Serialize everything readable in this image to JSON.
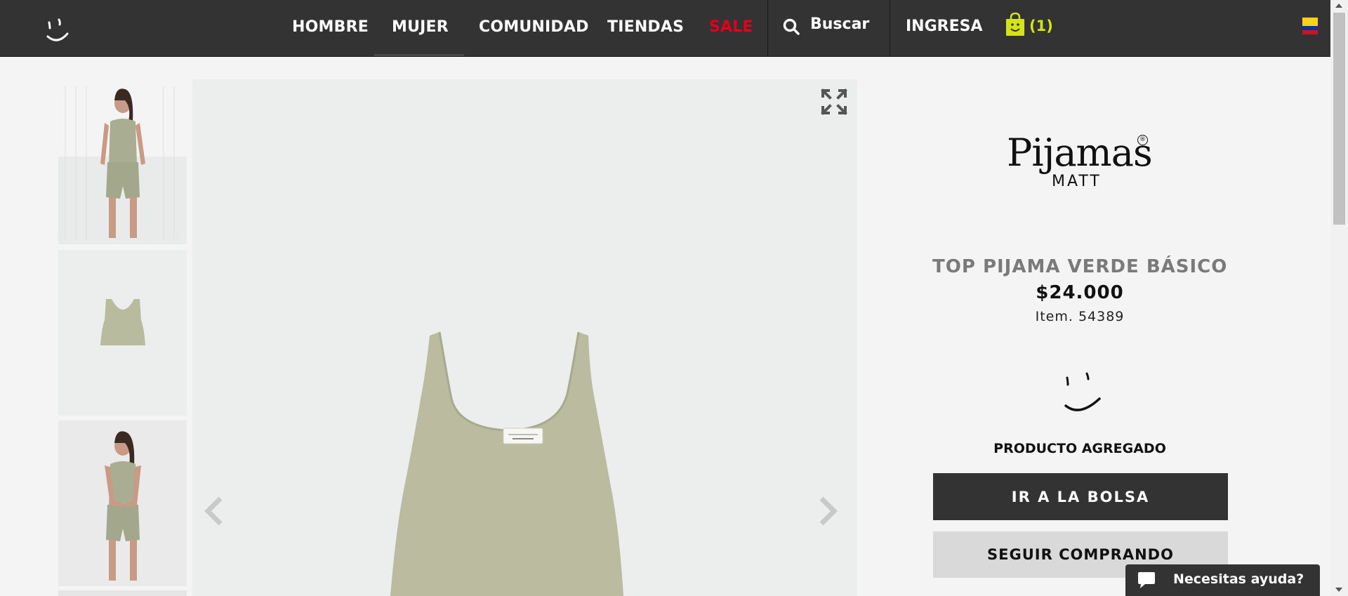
{
  "header": {
    "logo_icon": "smile-logo-icon",
    "nav": [
      "HOMBRE",
      "MUJER",
      "COMUNIDAD",
      "TIENDAS",
      "SALE"
    ],
    "sale_color": "#e3001b",
    "search_label": "Buscar",
    "login_label": "INGRESA",
    "bag_count": "(1)",
    "accent_color": "#d4e60e"
  },
  "gallery": {
    "thumbnails": [
      "model-front-thumbnail",
      "top-product-thumbnail",
      "model-pose-thumbnail"
    ],
    "main_image": "green-tank-top-image"
  },
  "brand": {
    "name": "Pijamas",
    "sub": "MATT",
    "reg": "®"
  },
  "product": {
    "title": "TOP PIJAMA VERDE BÁSICO",
    "price": "$24.000",
    "item": "Item. 54389",
    "added_label": "PRODUCTO AGREGADO",
    "go_to_bag": "IR A LA BOLSA",
    "continue_shopping": "SEGUIR COMPRANDO"
  },
  "help": {
    "label": "Necesitas ayuda?"
  }
}
